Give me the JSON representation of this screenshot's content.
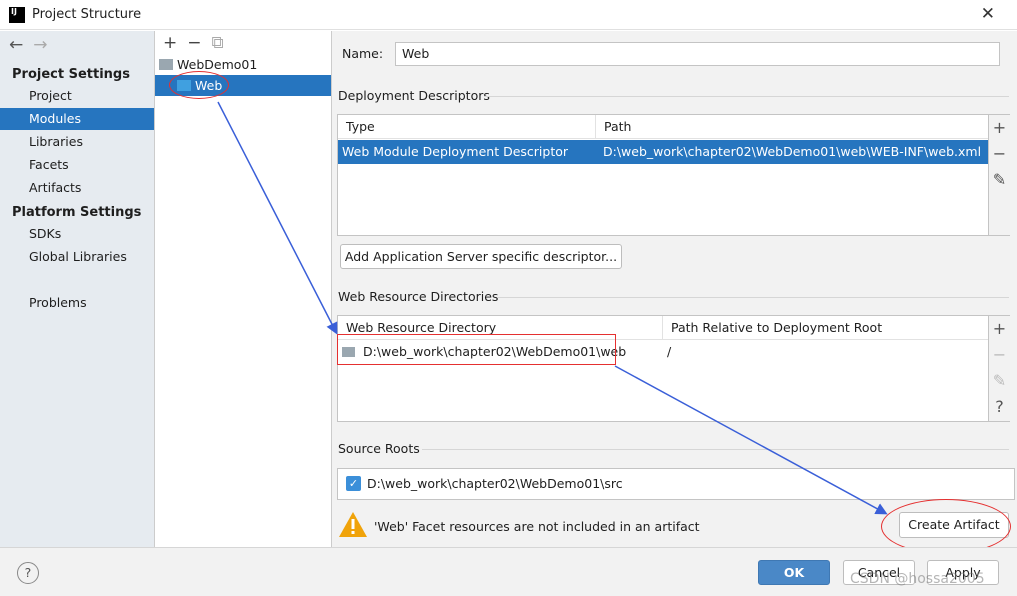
{
  "window": {
    "title": "Project Structure",
    "logo": "IJ",
    "close_icon": "close-icon"
  },
  "sidebar": {
    "sections": [
      {
        "label": "Project Settings",
        "items": [
          "Project",
          "Modules",
          "Libraries",
          "Facets",
          "Artifacts"
        ]
      },
      {
        "label": "Platform Settings",
        "items": [
          "SDKs",
          "Global Libraries"
        ]
      }
    ],
    "problems": "Problems",
    "selected": "Modules"
  },
  "tree": {
    "toolbar": [
      "+",
      "−",
      "⧉"
    ],
    "nodes": [
      {
        "label": "WebDemo01"
      },
      {
        "label": "Web",
        "selected": true
      }
    ]
  },
  "main": {
    "name_label": "Name:",
    "name_value": "Web",
    "deployment": {
      "title": "Deployment Descriptors",
      "columns": [
        "Type",
        "Path"
      ],
      "rows": [
        [
          "Web Module Deployment Descriptor",
          "D:\\web_work\\chapter02\\WebDemo01\\web\\WEB-INF\\web.xml"
        ]
      ],
      "add_button": "Add Application Server specific descriptor..."
    },
    "resources": {
      "title": "Web Resource Directories",
      "columns": [
        "Web Resource Directory",
        "Path Relative to Deployment Root"
      ],
      "rows": [
        [
          "D:\\web_work\\chapter02\\WebDemo01\\web",
          "/"
        ]
      ]
    },
    "sources": {
      "title": "Source Roots",
      "rows": [
        {
          "checked": true,
          "path": "D:\\web_work\\chapter02\\WebDemo01\\src"
        }
      ]
    },
    "warning": "'Web' Facet resources are not included in an artifact",
    "create_artifact": "Create Artifact"
  },
  "footer": {
    "help": "?",
    "ok": "OK",
    "cancel": "Cancel",
    "apply": "Apply"
  },
  "watermark": "CSDN @hossa2005",
  "colors": {
    "selection": "#2675bf",
    "annotation_red": "#e53030",
    "annotation_arrow": "#3a5fd8"
  }
}
